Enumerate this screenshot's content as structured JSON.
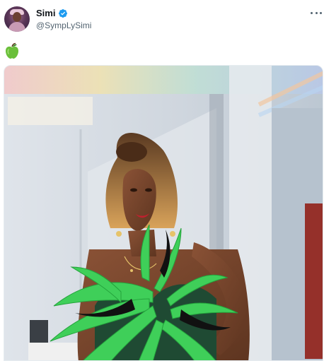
{
  "tweet": {
    "author": {
      "display_name": "Simi",
      "handle": "@SympLySimi",
      "verified": true
    },
    "text_emoji": "green-apple-emoji",
    "more_icon": "more-icon",
    "media_description_icon": "photo"
  },
  "colors": {
    "verified_badge": "#1d9bf0",
    "text_primary": "#0f1419",
    "text_secondary": "#536471",
    "apple_green": "#6abf3a",
    "feather_green": "#2fbf4a"
  }
}
